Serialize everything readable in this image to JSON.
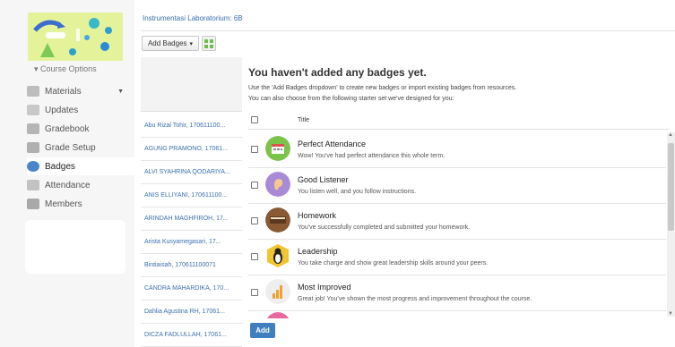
{
  "breadcrumb": "Instrumentasi Laboratorium: 6B",
  "sidebar": {
    "course_options_label": "Course Options",
    "items": [
      {
        "label": "Materials",
        "icon": "materials-icon"
      },
      {
        "label": "Updates",
        "icon": "updates-icon"
      },
      {
        "label": "Gradebook",
        "icon": "gradebook-icon"
      },
      {
        "label": "Grade Setup",
        "icon": "grade-setup-icon"
      },
      {
        "label": "Badges",
        "icon": "badge-icon"
      },
      {
        "label": "Attendance",
        "icon": "attendance-icon"
      },
      {
        "label": "Members",
        "icon": "members-icon"
      }
    ]
  },
  "toolbar": {
    "add_badges_label": "Add Badges"
  },
  "empty_state": {
    "title": "You haven't added any badges yet.",
    "line1": "Use the 'Add Badges dropdown' to create new badges or import existing badges from resources.",
    "line2": "You can also choose from the following starter set we've designed for you:"
  },
  "badge_table": {
    "title_header": "Title",
    "badges": [
      {
        "name": "Perfect Attendance",
        "description": "Wow! You've had perfect attendance this whole term.",
        "icon": "calendar-icon"
      },
      {
        "name": "Good Listener",
        "description": "You listen well, and you follow instructions.",
        "icon": "ear-icon"
      },
      {
        "name": "Homework",
        "description": "You've successfully completed and submitted your homework.",
        "icon": "book-icon"
      },
      {
        "name": "Leadership",
        "description": "You take charge and show great leadership skills around your peers.",
        "icon": "penguin-icon"
      },
      {
        "name": "Most Improved",
        "description": "Great job! You've shown the most progress and improvement throughout the course.",
        "icon": "chart-icon"
      }
    ]
  },
  "students": [
    "Abu Rizal Tohir, 170611100...",
    "AGUNG PRAMONO, 17061...",
    "ALVI SYAHRINA QODARIYA...",
    "ANIS ELLIYANI, 170611100...",
    "ARINDAH MAGHFIROH, 17...",
    "Arista Kusyamegasari, 17...",
    "Bintiaisah, 170611100071",
    "CANDRA MAHARDIKA, 170...",
    "Dahlia Agustina RH, 17061...",
    "DICZA FADLULLAH, 17061..."
  ],
  "add_button_label": "Add",
  "colors": {
    "accent": "#3f7fc0",
    "link": "#3a6fb0",
    "sidebar_bg": "#f6f6f6"
  }
}
